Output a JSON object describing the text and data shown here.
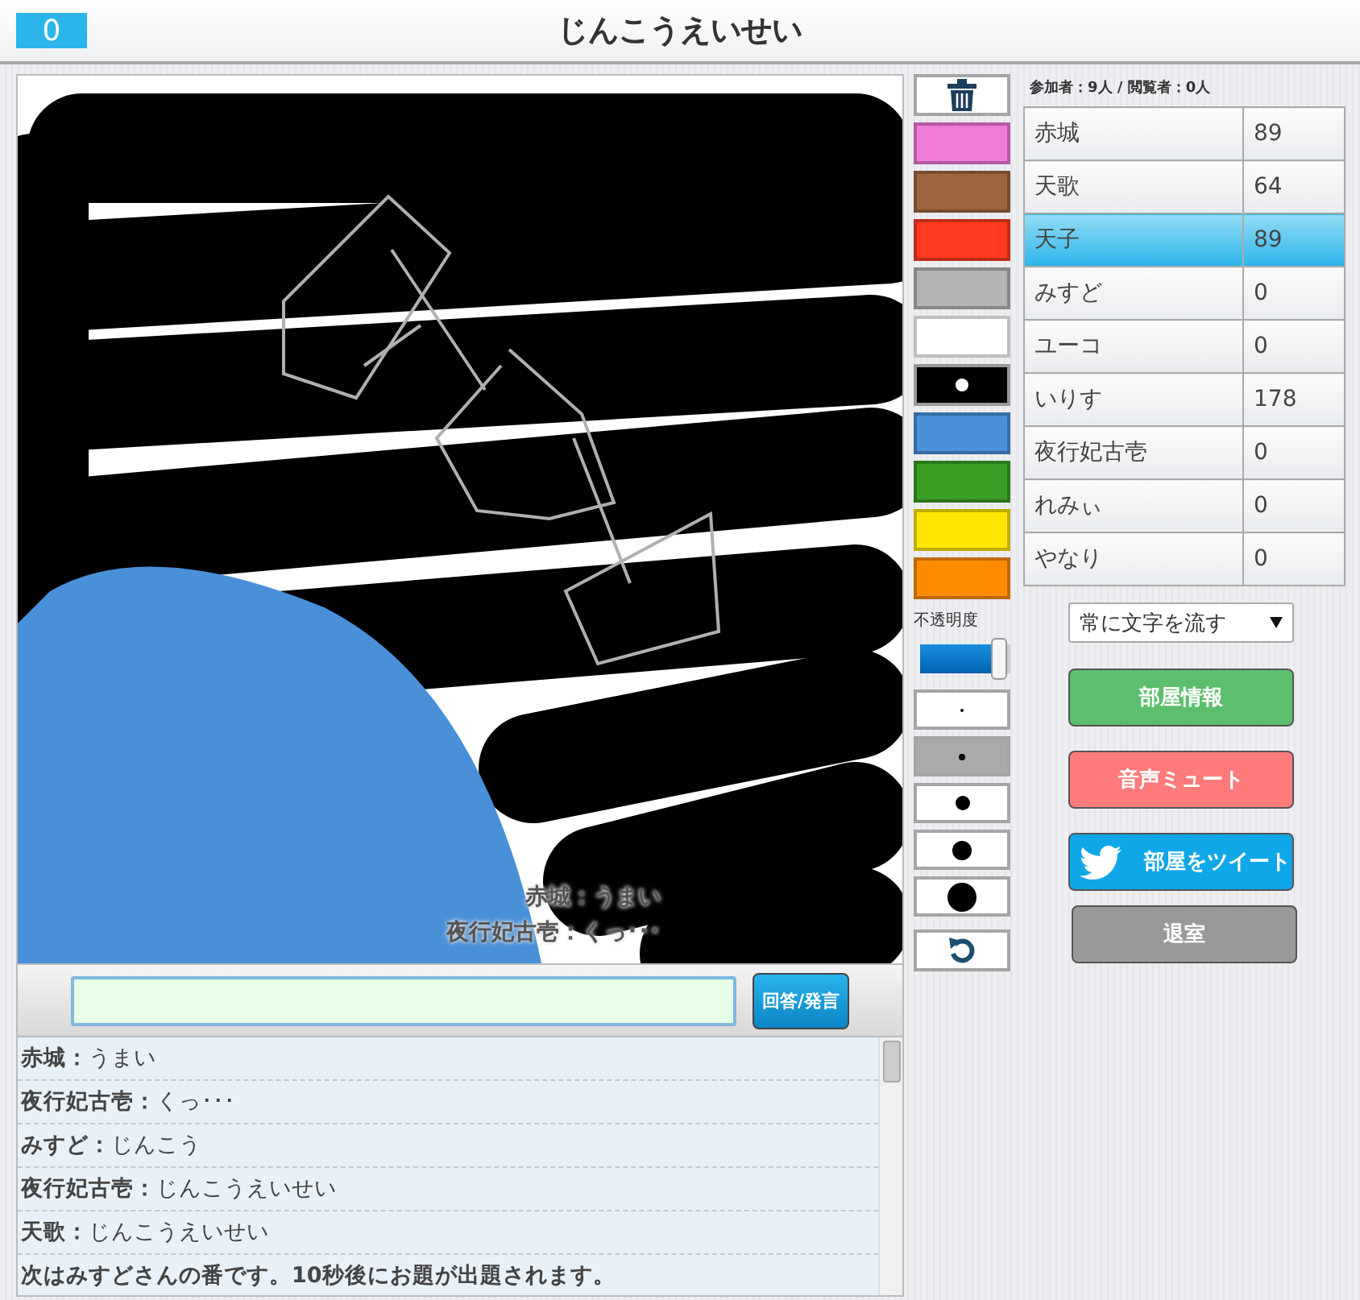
{
  "header": {
    "score": "0",
    "title": "じんこうえいせい"
  },
  "canvas": {
    "overlay_messages": [
      "赤城：うまい",
      "夜行妃古壱：くっ･･･"
    ]
  },
  "answer": {
    "send_button": "回答/発言"
  },
  "chat": [
    {
      "kind": "user",
      "name": "赤城：",
      "message": "うまい"
    },
    {
      "kind": "user",
      "name": "夜行妃古壱：",
      "message": "くっ･･･"
    },
    {
      "kind": "user",
      "name": "みすど：",
      "message": "じんこう"
    },
    {
      "kind": "user",
      "name": "夜行妃古壱：",
      "message": "じんこうえいせい"
    },
    {
      "kind": "user",
      "name": "天歌：",
      "message": "じんこうえいせい"
    },
    {
      "kind": "system",
      "message": "次はみすどさんの番です。10秒後にお題が出題されます。"
    }
  ],
  "tools": {
    "palette": [
      {
        "color": "#ef7ad8",
        "selected": false
      },
      {
        "color": "#9c6640",
        "selected": false
      },
      {
        "color": "#ff3a20",
        "selected": false
      },
      {
        "color": "#b4b4b4",
        "selected": false
      },
      {
        "color": "#ffffff",
        "selected": false
      },
      {
        "color": "#000000",
        "selected": true
      },
      {
        "color": "#4a90d9",
        "selected": false
      },
      {
        "color": "#3a9e25",
        "selected": false
      },
      {
        "color": "#ffe600",
        "selected": false
      },
      {
        "color": "#ff8c00",
        "selected": false
      }
    ],
    "opacity": {
      "label": "不透明度",
      "level": 0.95
    },
    "brush_sizes": [
      {
        "selected": false
      },
      {
        "selected": true
      },
      {
        "selected": false
      },
      {
        "selected": false
      },
      {
        "selected": false
      }
    ]
  },
  "players": {
    "summary": "参加者：9人 / 閲覧者：0人",
    "rows": [
      {
        "name": "赤城",
        "score": "89",
        "selected": false
      },
      {
        "name": "天歌",
        "score": "64",
        "selected": false
      },
      {
        "name": "天子",
        "score": "89",
        "selected": true
      },
      {
        "name": "みすど",
        "score": "0",
        "selected": false
      },
      {
        "name": "ユーコ",
        "score": "0",
        "selected": false
      },
      {
        "name": "いりす",
        "score": "178",
        "selected": false
      },
      {
        "name": "夜行妃古壱",
        "score": "0",
        "selected": false
      },
      {
        "name": "れみぃ",
        "score": "0",
        "selected": false
      },
      {
        "name": "やなり",
        "score": "0",
        "selected": false
      }
    ]
  },
  "scroll_mode": {
    "value": "常に文字を流す"
  },
  "buttons": [
    {
      "label": "部屋情報",
      "kind": "info"
    },
    {
      "label": "音声ミュート",
      "kind": "mute"
    },
    {
      "label": "部屋をツイート",
      "kind": "tweet"
    },
    {
      "label": "退室",
      "kind": "leave"
    }
  ]
}
